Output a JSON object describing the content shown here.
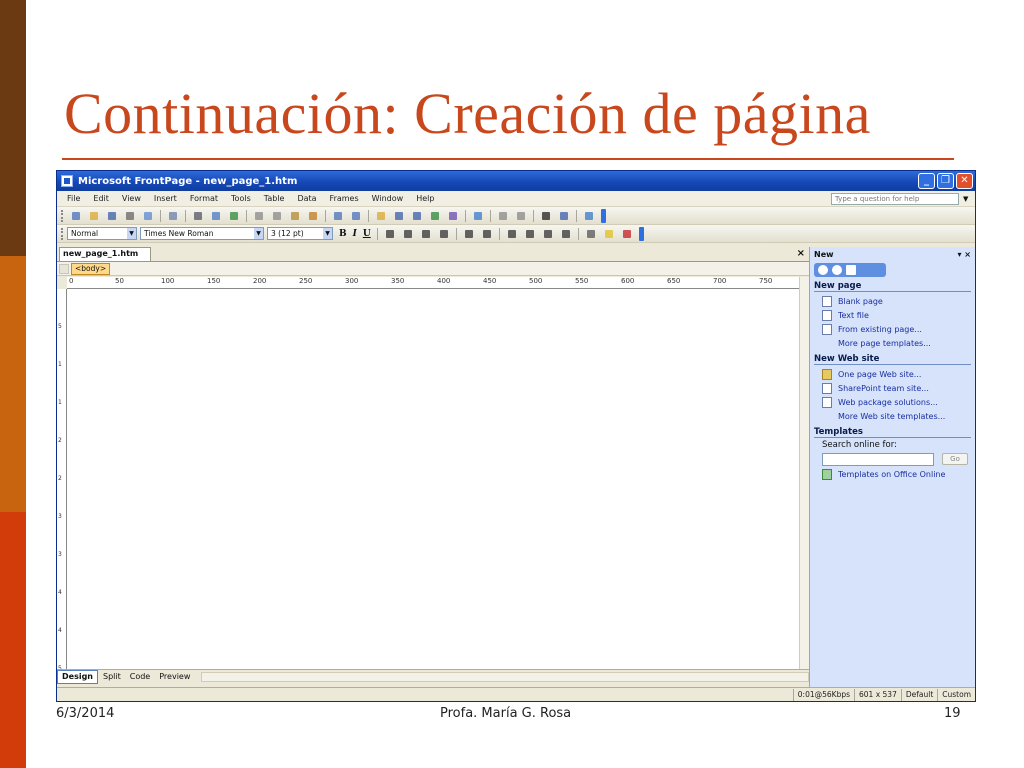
{
  "slide": {
    "title": "Continuación: Creación de página",
    "footer": {
      "date": "6/3/2014",
      "author": "Profa. María G. Rosa",
      "page": "19"
    }
  },
  "colors": {
    "title": "#c8471c",
    "accent_dark": "#6b3a12",
    "accent_mid": "#c86410",
    "accent_light": "#d23c0a",
    "xp_title_blue": "#1648b8",
    "task_pane": "#d6e3fb"
  },
  "window": {
    "title": "Microsoft FrontPage - new_page_1.htm",
    "controls": [
      "_",
      "❐",
      "✕"
    ]
  },
  "menubar": {
    "items": [
      "File",
      "Edit",
      "View",
      "Insert",
      "Format",
      "Tools",
      "Table",
      "Data",
      "Frames",
      "Window",
      "Help"
    ],
    "help_placeholder": "Type a question for help"
  },
  "formatting": {
    "style": "Normal",
    "font": "Times New Roman",
    "size": "3 (12 pt)",
    "bold": "B",
    "italic": "I",
    "underline": "U"
  },
  "document": {
    "tab_label": "new_page_1.htm",
    "close_glyph": "×",
    "quick_tag": "<body>",
    "ruler_h": [
      "0",
      "50",
      "100",
      "150",
      "200",
      "250",
      "300",
      "350",
      "400",
      "450",
      "500",
      "550",
      "600",
      "650",
      "700",
      "750"
    ],
    "ruler_v": [
      "50",
      "100",
      "150",
      "200",
      "250",
      "300",
      "350",
      "400",
      "450",
      "500"
    ],
    "view_tabs": [
      "Design",
      "Split",
      "Code",
      "Preview"
    ]
  },
  "task_pane": {
    "title": "New",
    "controls": "▾ ×",
    "new_page": {
      "heading": "New page",
      "items": [
        "Blank page",
        "Text file",
        "From existing page...",
        "More page templates..."
      ]
    },
    "new_web_site": {
      "heading": "New Web site",
      "items": [
        "One page Web site...",
        "SharePoint team site...",
        "Web package solutions...",
        "More Web site templates..."
      ]
    },
    "templates": {
      "heading": "Templates",
      "search_label": "Search online for:",
      "go_label": "Go",
      "office_online": "Templates on Office Online"
    }
  },
  "statusbar": {
    "speed": "0:01@56Kbps",
    "dimensions": "601 x 537",
    "mode": "Default",
    "custom": "Custom"
  }
}
